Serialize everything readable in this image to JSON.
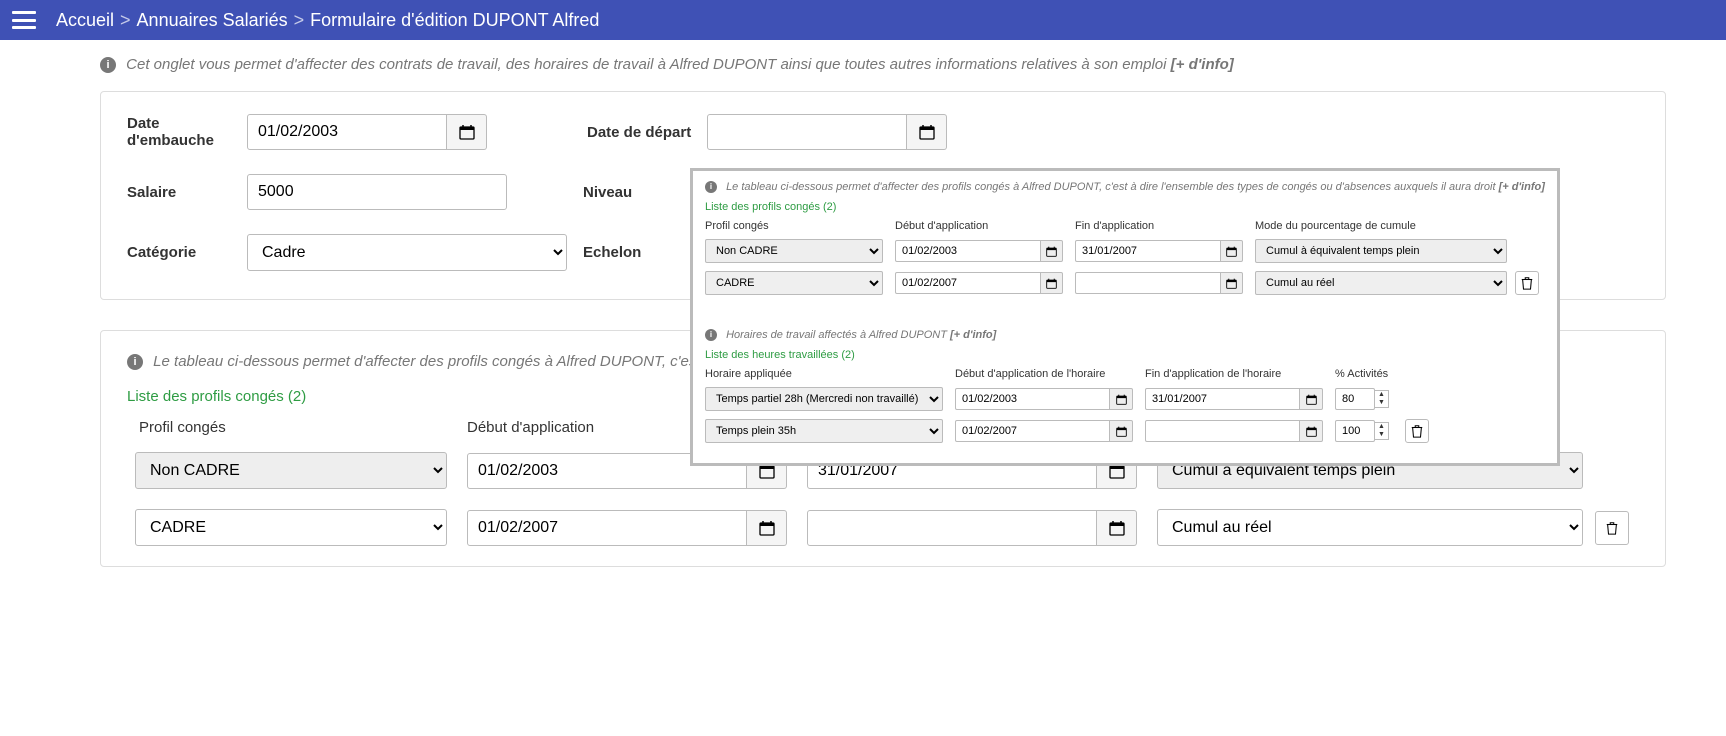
{
  "breadcrumb": {
    "home": "Accueil",
    "dir": "Annuaires Salariés",
    "form": "Formulaire d'édition DUPONT Alfred"
  },
  "info": {
    "main_text": "Cet onglet vous permet d'affecter des contrats de travail, des horaires de travail à Alfred DUPONT ainsi que toutes autres informations relatives à son emploi ",
    "more": "[+ d'info]"
  },
  "form": {
    "date_embauche_label": "Date d'embauche",
    "date_embauche": "01/02/2003",
    "date_depart_label": "Date de départ",
    "date_depart": "",
    "salaire_label": "Salaire",
    "salaire": "5000",
    "niveau_label": "Niveau",
    "categorie_label": "Catégorie",
    "categorie": "Cadre",
    "echelon_label": "Echelon"
  },
  "profils_block": {
    "info_text": "Le tableau ci-dessous permet d'affecter des profils congés à Alfred DUPONT, c'est",
    "list_label": "Liste des profils congés (2)",
    "headers": {
      "profil": "Profil congés",
      "debut": "Début d'application",
      "fin": "Fin d'application",
      "mode": "Mode du pourcentage de cumule"
    },
    "rows": [
      {
        "profil": "Non CADRE",
        "debut": "01/02/2003",
        "fin": "31/01/2007",
        "mode": "Cumul à équivalent temps plein",
        "locked": true
      },
      {
        "profil": "CADRE",
        "debut": "01/02/2007",
        "fin": "",
        "mode": "Cumul au réel",
        "locked": false
      }
    ]
  },
  "popup": {
    "profils": {
      "info_text": "Le tableau ci-dessous permet d'affecter des profils congés à Alfred DUPONT, c'est à dire l'ensemble des types de congés ou d'absences auxquels il aura droit ",
      "more": "[+ d'info]",
      "list_label": "Liste des profils congés (2)",
      "headers": {
        "profil": "Profil congés",
        "debut": "Début d'application",
        "fin": "Fin d'application",
        "mode": "Mode du pourcentage de cumule"
      },
      "rows": [
        {
          "profil": "Non CADRE",
          "debut": "01/02/2003",
          "fin": "31/01/2007",
          "mode": "Cumul à équivalent temps plein",
          "locked": true
        },
        {
          "profil": "CADRE",
          "debut": "01/02/2007",
          "fin": "",
          "mode": "Cumul au réel",
          "locked": false
        }
      ]
    },
    "horaires": {
      "info_text": "Horaires de travail affectés à Alfred DUPONT ",
      "more": "[+ d'info]",
      "list_label": "Liste des heures travaillées (2)",
      "headers": {
        "horaire": "Horaire appliquée",
        "debut": "Début d'application de l'horaire",
        "fin": "Fin d'application de l'horaire",
        "pct": "% Activités"
      },
      "rows": [
        {
          "horaire": "Temps partiel 28h (Mercredi non travaillé)",
          "debut": "01/02/2003",
          "fin": "31/01/2007",
          "pct": "80",
          "locked": true
        },
        {
          "horaire": "Temps plein 35h",
          "debut": "01/02/2007",
          "fin": "",
          "pct": "100",
          "locked": false
        }
      ]
    }
  }
}
